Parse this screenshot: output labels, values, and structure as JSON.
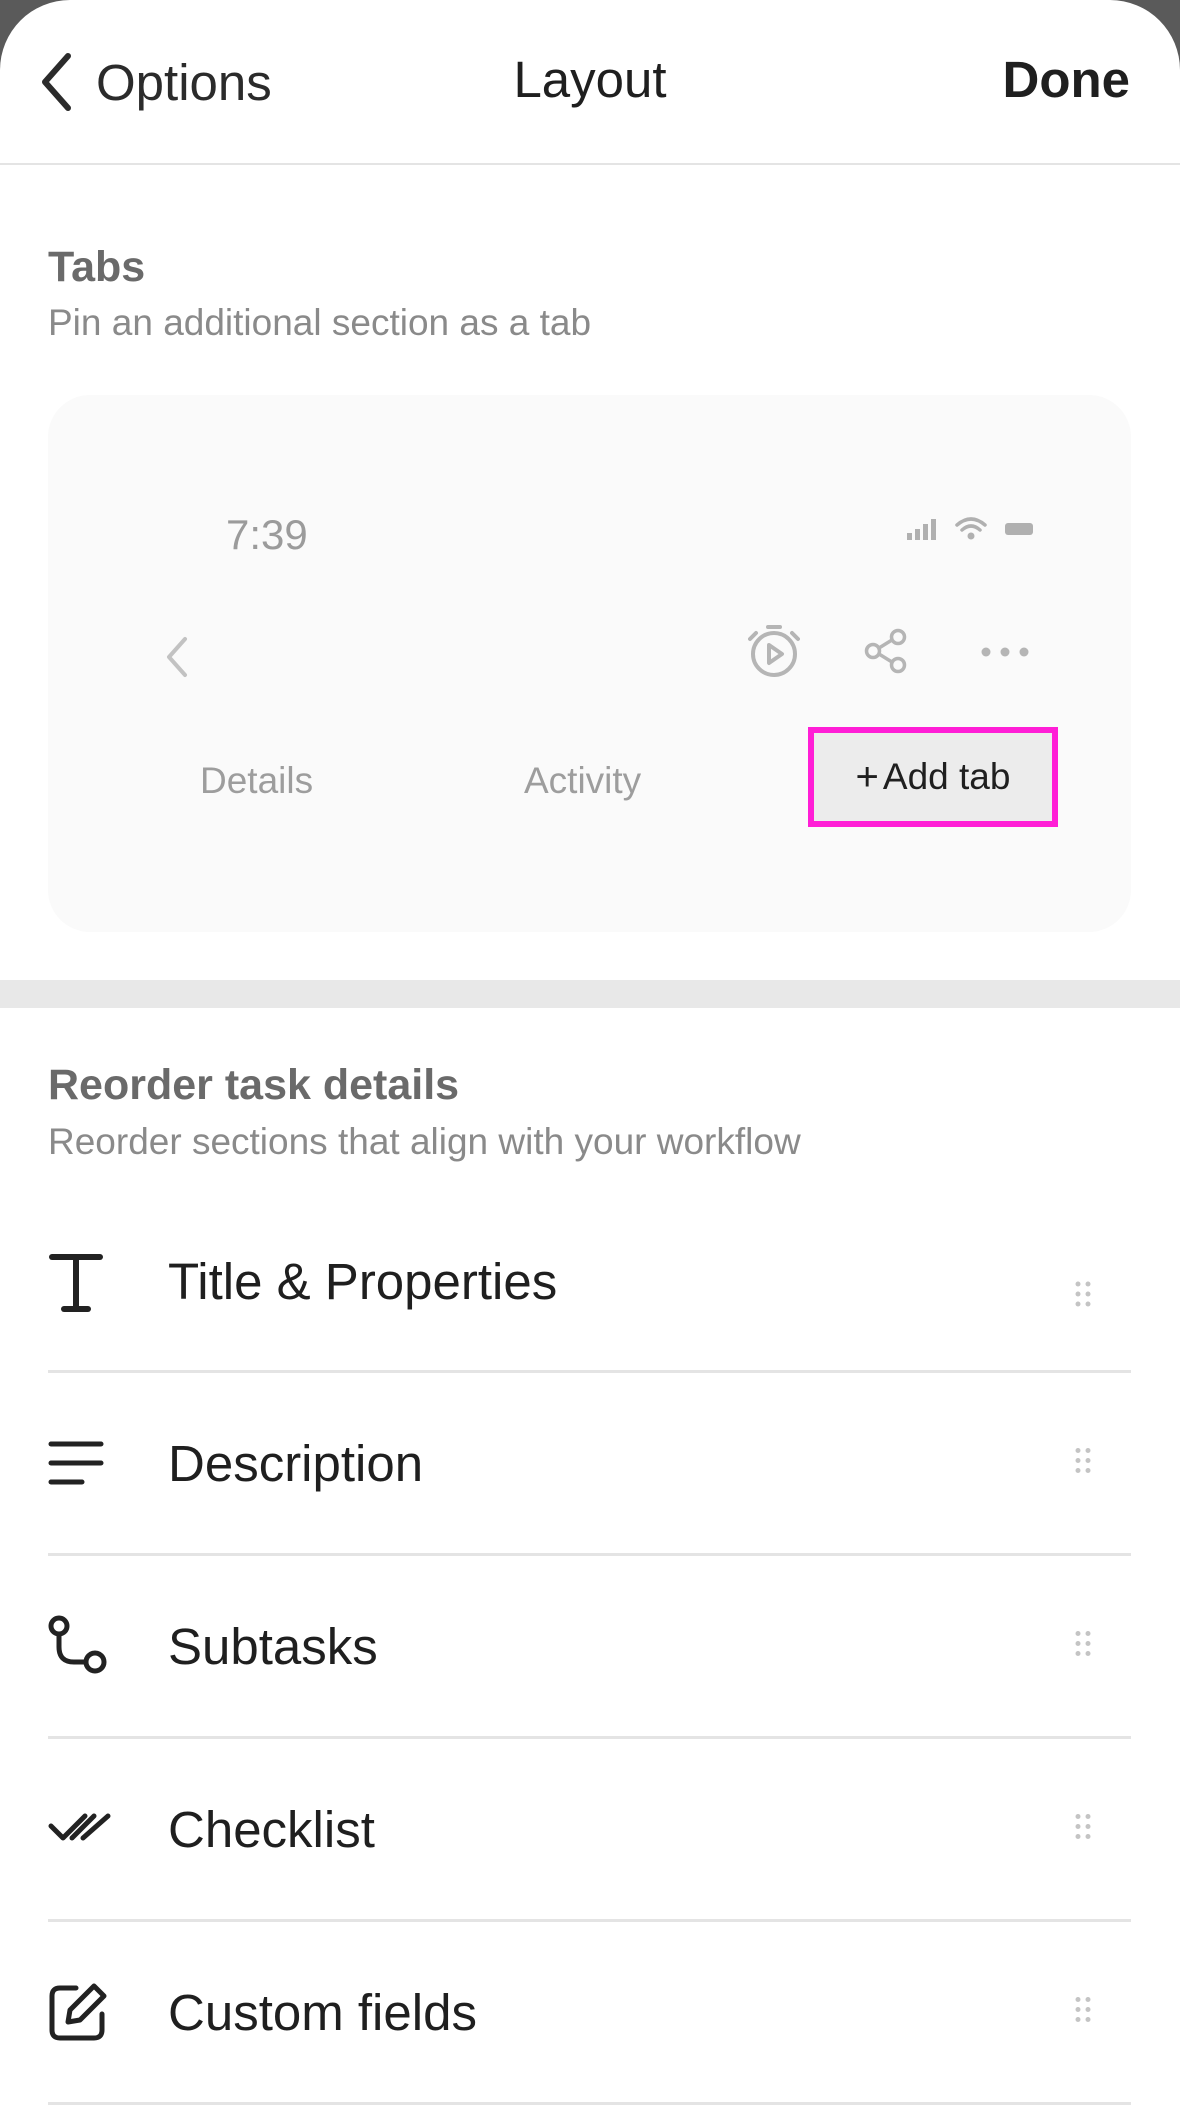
{
  "header": {
    "back_label": "Options",
    "title": "Layout",
    "done_label": "Done"
  },
  "tabs_section": {
    "title": "Tabs",
    "subtitle": "Pin an additional section as a tab"
  },
  "preview": {
    "time": "7:39",
    "tabs": [
      "Details",
      "Activity"
    ],
    "add_tab_label": "Add tab",
    "add_tab_plus": "+",
    "highlight_color": "#ff1ed6"
  },
  "reorder_section": {
    "title": "Reorder task details",
    "subtitle": "Reorder sections that align with your workflow",
    "items": [
      {
        "label": "Title & Properties",
        "icon": "text-icon"
      },
      {
        "label": "Description",
        "icon": "lines-icon"
      },
      {
        "label": "Subtasks",
        "icon": "subtasks-icon"
      },
      {
        "label": "Checklist",
        "icon": "double-check-icon"
      },
      {
        "label": "Custom fields",
        "icon": "edit-square-icon"
      }
    ]
  }
}
